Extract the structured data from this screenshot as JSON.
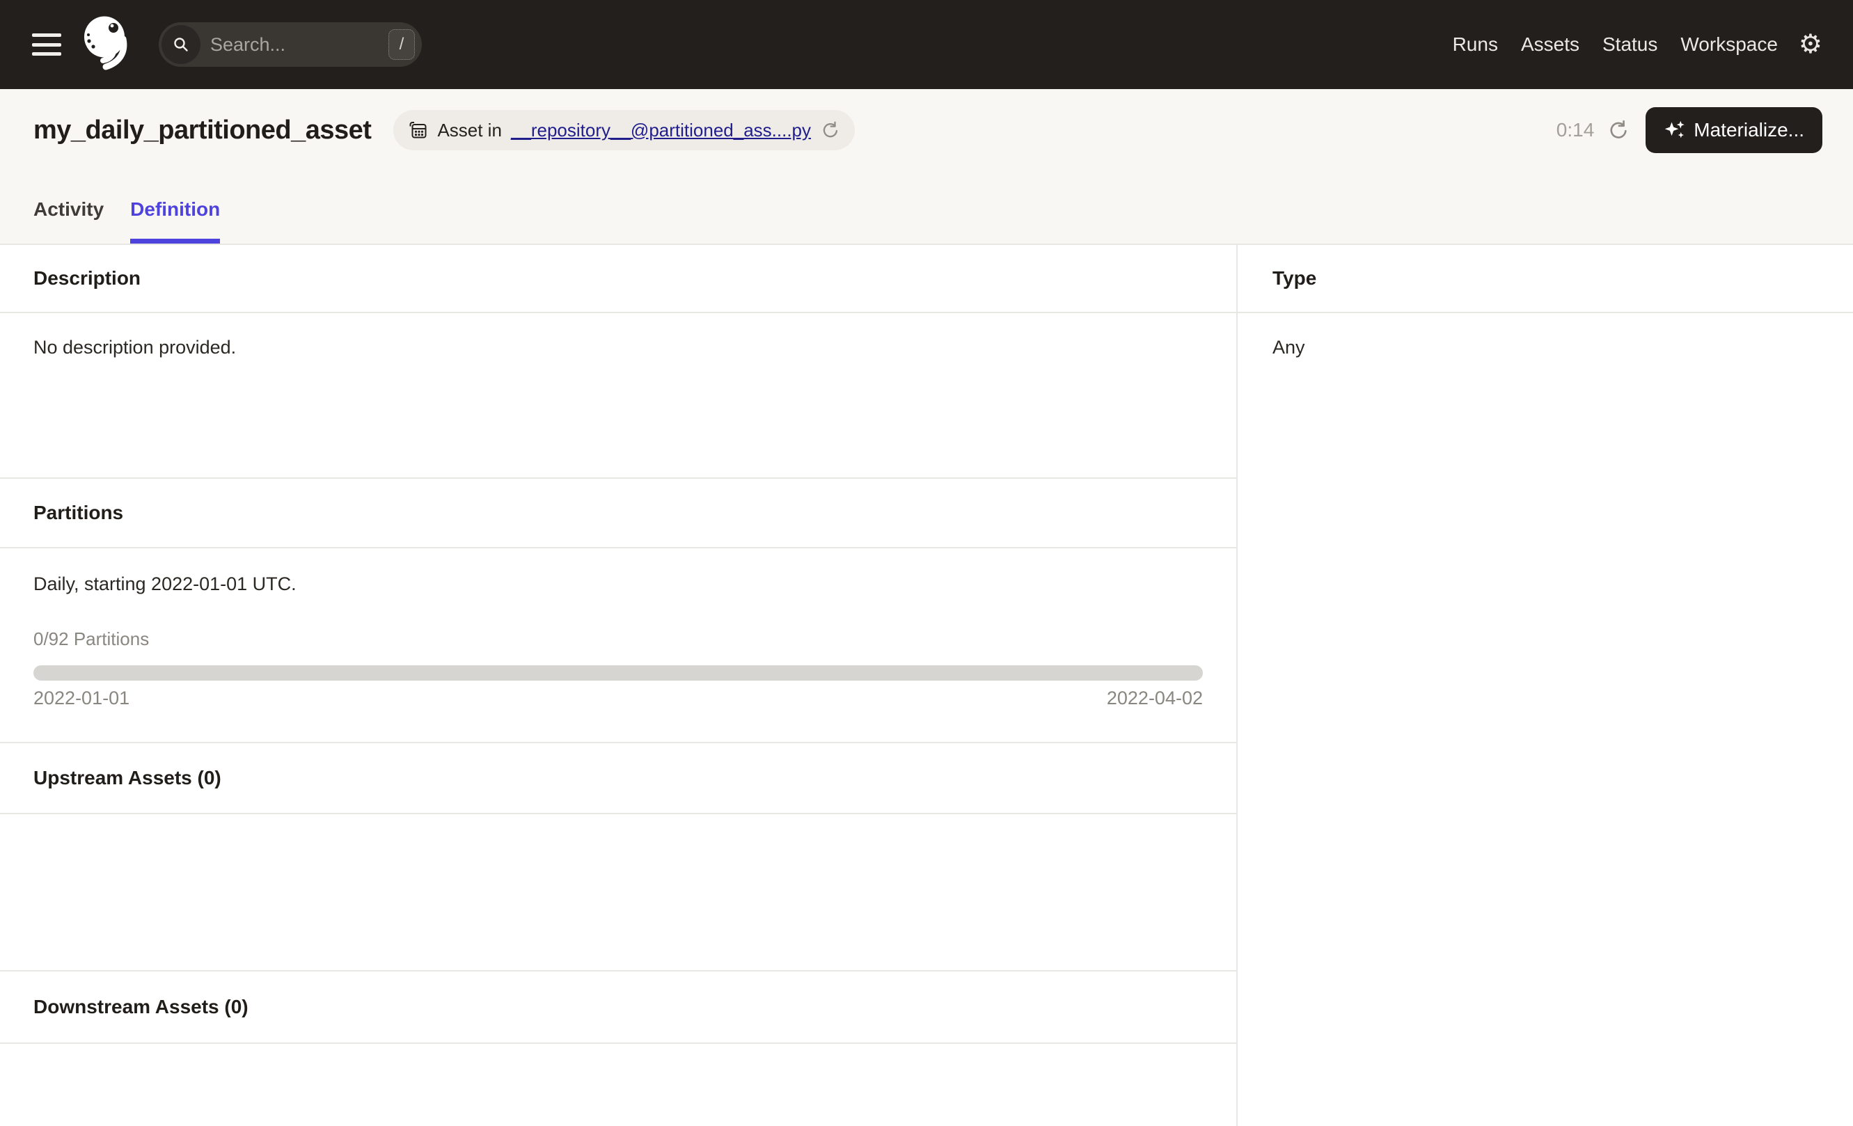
{
  "topnav": {
    "search_placeholder": "Search...",
    "search_shortcut": "/",
    "nav_items": [
      {
        "label": "Runs"
      },
      {
        "label": "Assets"
      },
      {
        "label": "Status"
      },
      {
        "label": "Workspace"
      }
    ]
  },
  "header": {
    "title": "my_daily_partitioned_asset",
    "badge": {
      "prefix": "Asset in",
      "link_text": "__repository__@partitioned_ass....py"
    },
    "refresh_countdown": "0:14",
    "materialize_label": "Materialize..."
  },
  "tabs": [
    {
      "label": "Activity",
      "active": false
    },
    {
      "label": "Definition",
      "active": true
    }
  ],
  "sections": {
    "description": {
      "heading": "Description",
      "empty_text": "No description provided."
    },
    "partitions": {
      "heading": "Partitions",
      "summary": "Daily, starting 2022-01-01 UTC.",
      "progress_label": "0/92 Partitions",
      "progress_percent": 0,
      "range_start": "2022-01-01",
      "range_end": "2022-04-02"
    },
    "upstream": {
      "heading": "Upstream Assets (0)"
    },
    "downstream": {
      "heading": "Downstream Assets (0)"
    },
    "type": {
      "heading": "Type",
      "value": "Any"
    }
  },
  "icons": {
    "gear": "⚙",
    "menu": "hamburger",
    "logo": "dagster-octopus",
    "search": "magnifier",
    "asset_location": "repo-grid",
    "reload": "circular-arrow",
    "materialize": "sparkles"
  },
  "colors": {
    "topnav_bg": "#231F1C",
    "header_bg": "#F9F7F4",
    "accent_tab": "#4F43DD",
    "link": "#201D8C",
    "divider": "#E9E7E4",
    "muted_text": "#8A8781",
    "progress_track": "#D7D5D2"
  }
}
